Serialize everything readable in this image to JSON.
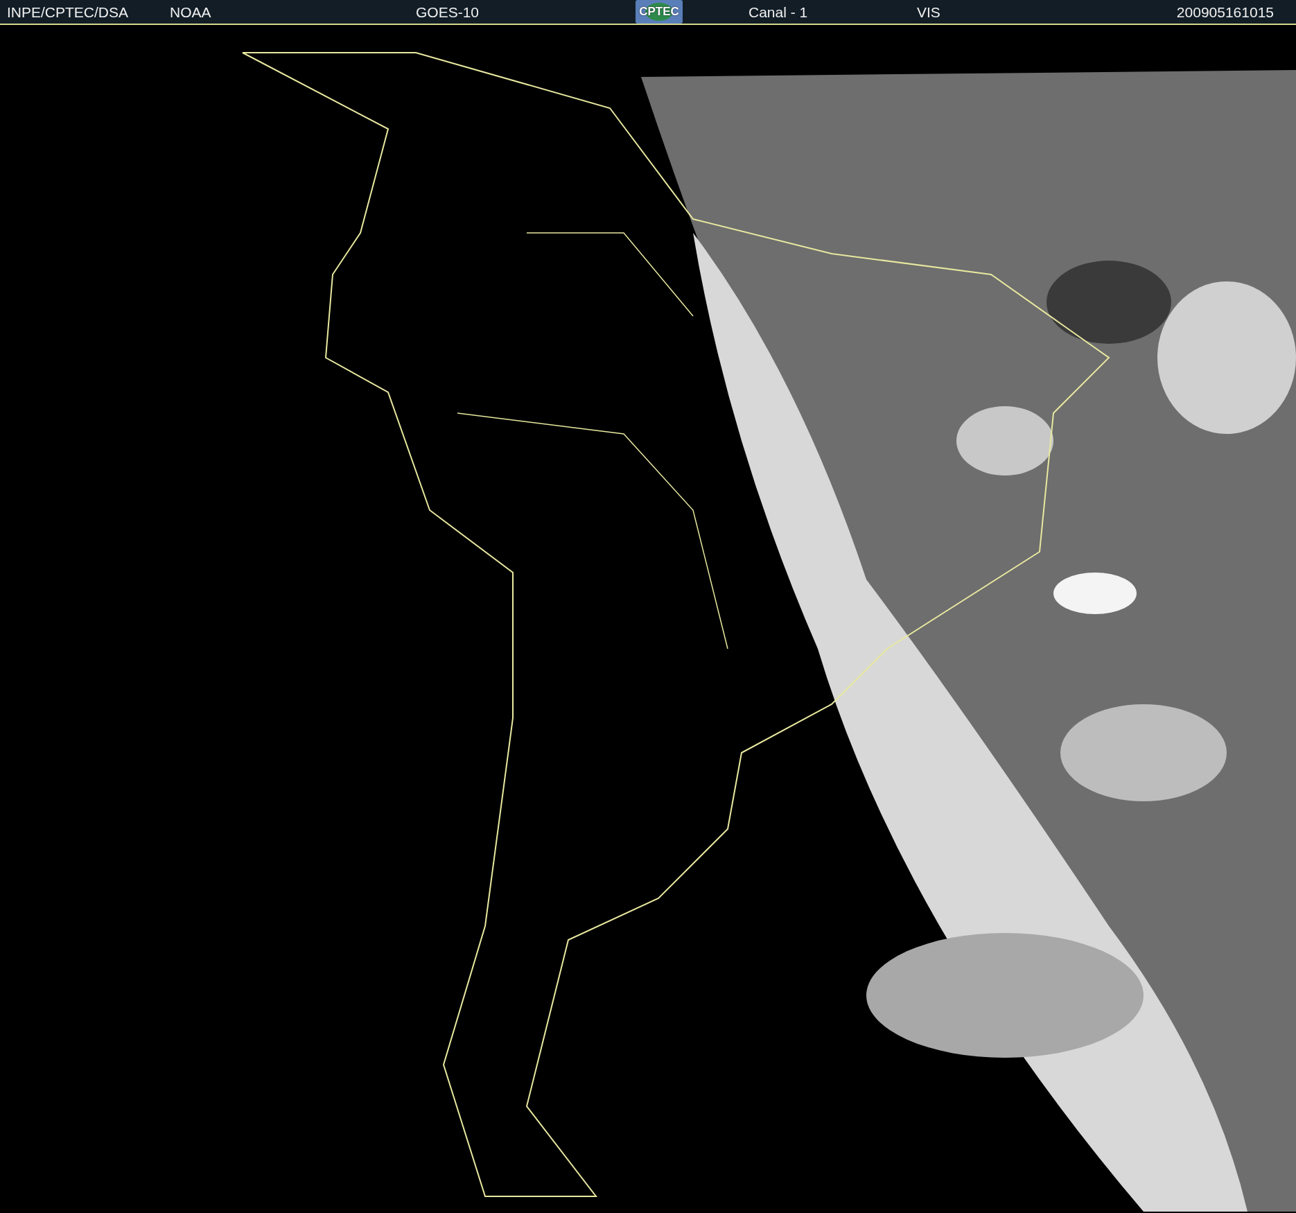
{
  "header": {
    "items": [
      {
        "kind": "text",
        "text": "INPE/CPTEC/DSA"
      },
      {
        "kind": "text",
        "text": "NOAA"
      },
      {
        "kind": "text",
        "text": "GOES-10"
      },
      {
        "kind": "logo",
        "text": "CPTEC"
      },
      {
        "kind": "text",
        "text": "Canal - 1"
      },
      {
        "kind": "text",
        "text": "VIS"
      },
      {
        "kind": "text",
        "text": "200905161015"
      }
    ]
  }
}
